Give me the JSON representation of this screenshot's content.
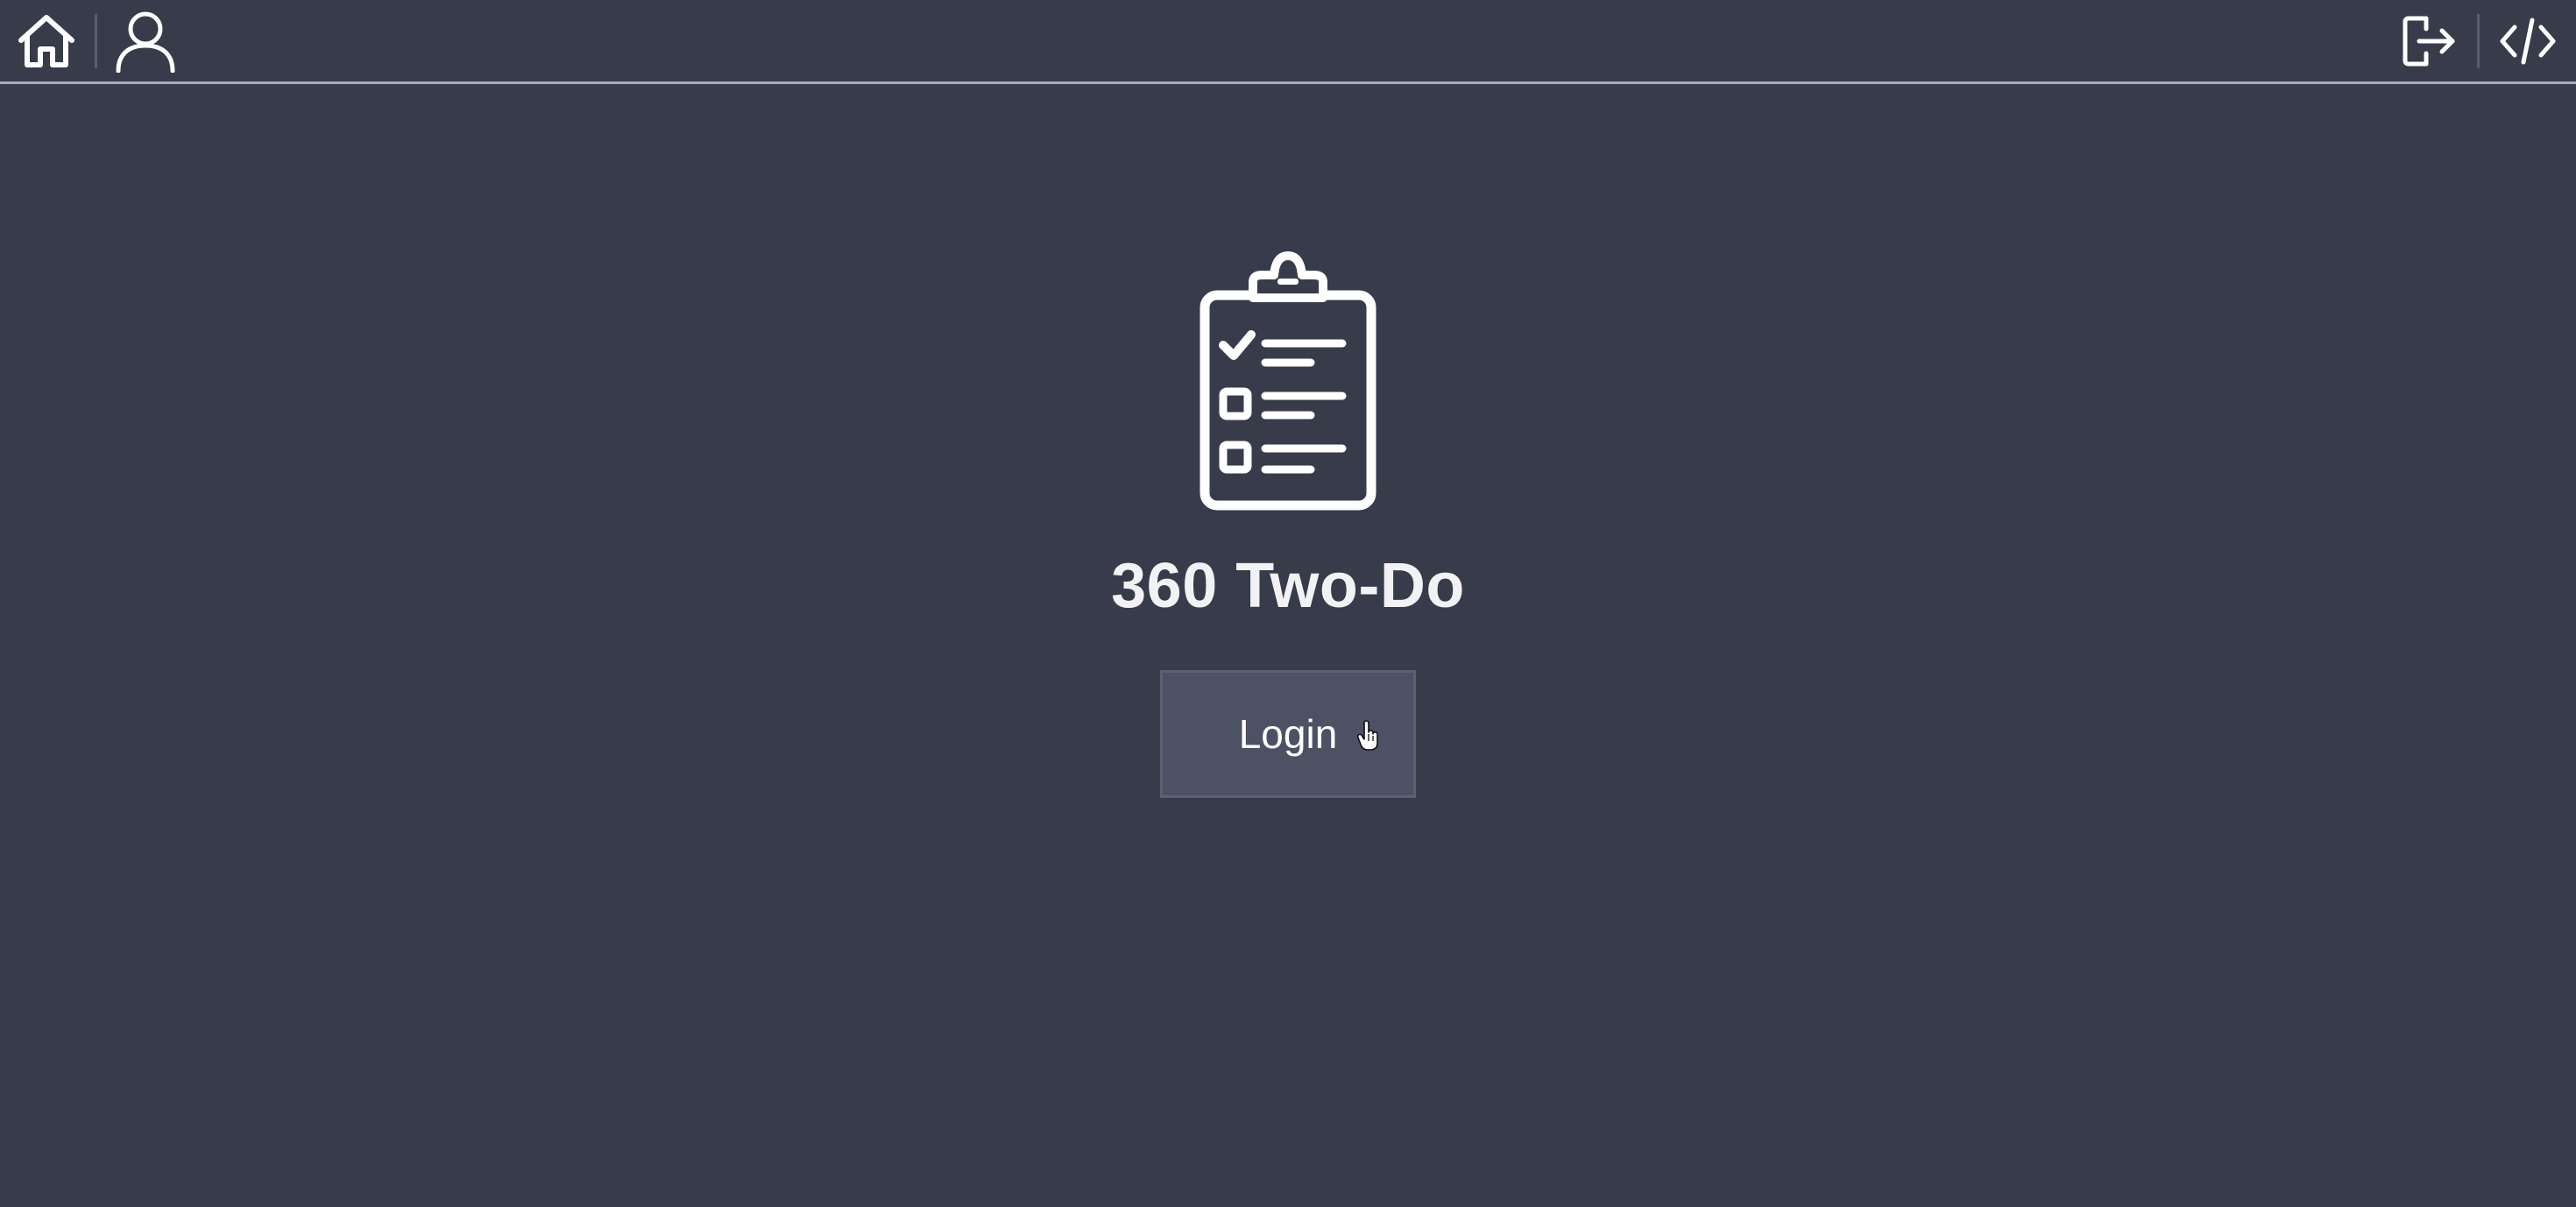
{
  "header": {
    "left_icons": [
      "home-icon",
      "user-icon"
    ],
    "right_icons": [
      "logout-icon",
      "code-icon"
    ]
  },
  "main": {
    "logo_icon": "clipboard-checklist-icon",
    "title": "360 Two-Do",
    "login_label": "Login"
  },
  "colors": {
    "background": "#373b4a",
    "button": "#4d5164",
    "header_border": "#a9acb6",
    "foreground": "#ffffff"
  }
}
